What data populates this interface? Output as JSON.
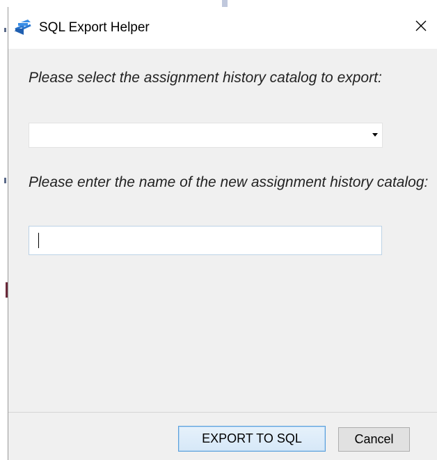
{
  "dialog": {
    "title": "SQL Export Helper",
    "close_icon": "close-icon",
    "app_icon": "sql-export-icon"
  },
  "form": {
    "catalog_prompt": "Please select the assignment history catalog to export:",
    "catalog_selected": "",
    "new_name_prompt": "Please enter the name of the new assignment history catalog:",
    "new_name_value": ""
  },
  "buttons": {
    "export_label": "EXPORT TO SQL",
    "cancel_label": "Cancel"
  },
  "colors": {
    "dialog_bg": "#f0f0f0",
    "titlebar_bg": "#ffffff",
    "accent_border": "#5aa0dc",
    "icon_blue": "#2b78d1"
  }
}
